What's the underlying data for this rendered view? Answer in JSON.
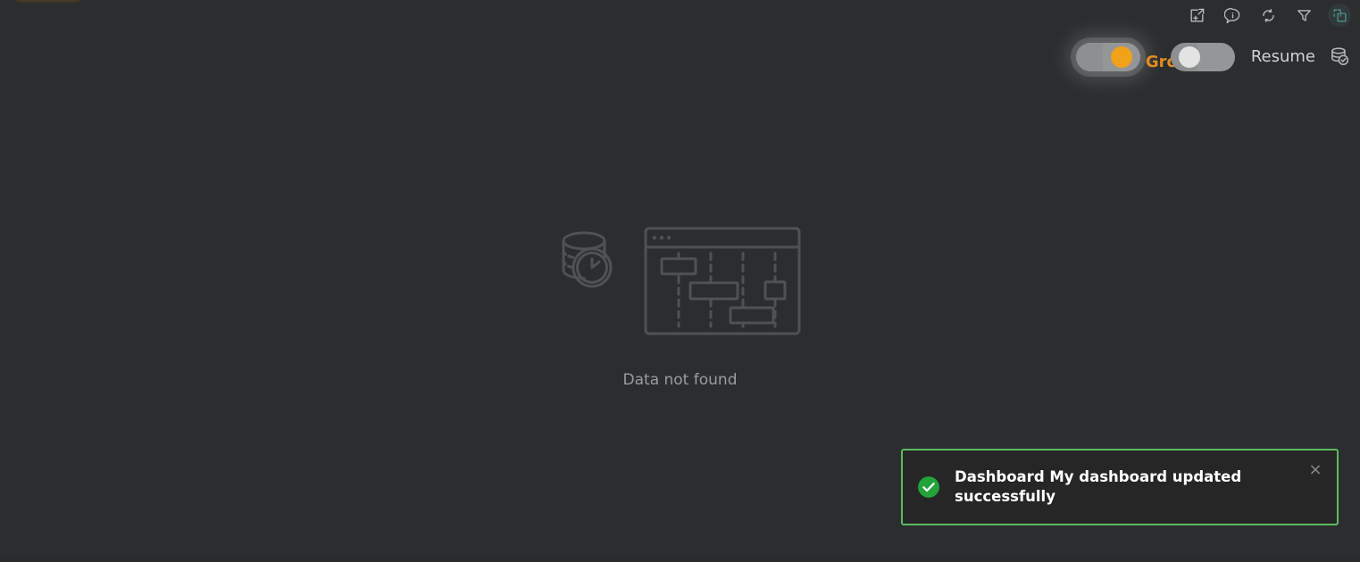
{
  "window": {
    "background_color": "#2b2d2f"
  },
  "toolbar": {
    "icons": [
      {
        "name": "export-icon",
        "title": "Export"
      },
      {
        "name": "info-icon",
        "title": "Info"
      },
      {
        "name": "refresh-icon",
        "title": "Refresh"
      },
      {
        "name": "filter-icon",
        "title": "Filter"
      },
      {
        "name": "duplicate-icon",
        "title": "Duplicate",
        "active": true,
        "color": "#4e8f8c"
      }
    ]
  },
  "controls": {
    "group_toggle": {
      "label": "Group",
      "state": "on",
      "knob_color": "#f0a21a",
      "focused": true
    },
    "resume_toggle": {
      "label": "Resume",
      "state": "off",
      "knob_color": "#e3e3e3",
      "focused": false
    },
    "database_icon": "database-check-icon"
  },
  "empty_state": {
    "message": "Data not found",
    "illustration": "database-clock-and-gantt-window"
  },
  "toast": {
    "message": "Dashboard My dashboard updated successfully",
    "status": "success",
    "status_icon": "check-circle-icon",
    "close_label": "×",
    "border_color": "#5cbb5f",
    "background_color": "#262626"
  }
}
